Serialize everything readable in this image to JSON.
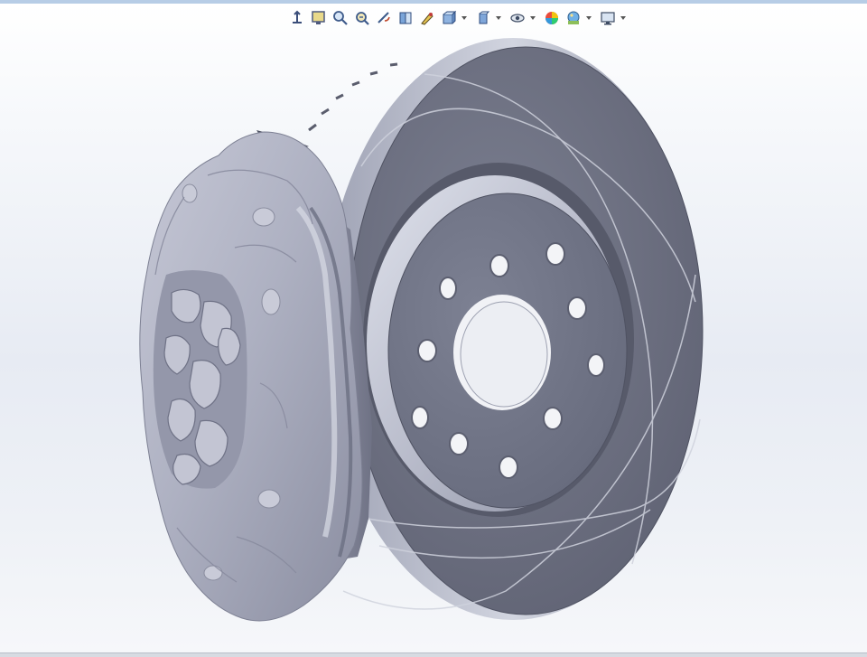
{
  "app": {
    "name": "3D CAD viewport",
    "accent_color": "#b7cde6"
  },
  "heads_up_toolbar": {
    "buttons": [
      {
        "icon": "previous-view-icon",
        "has_dropdown": false
      },
      {
        "icon": "zoom-to-fit-icon",
        "has_dropdown": false
      },
      {
        "icon": "zoom-to-area-icon",
        "has_dropdown": false
      },
      {
        "icon": "zoom-in-out-icon",
        "has_dropdown": false
      },
      {
        "icon": "rotate-view-icon",
        "has_dropdown": false
      },
      {
        "icon": "section-view-icon",
        "has_dropdown": false
      },
      {
        "icon": "dynamic-annotation-icon",
        "has_dropdown": false
      },
      {
        "icon": "view-orientation-icon",
        "has_dropdown": true
      },
      {
        "icon": "display-style-icon",
        "has_dropdown": true
      },
      {
        "icon": "hide-show-items-icon",
        "has_dropdown": true
      },
      {
        "icon": "edit-appearance-icon",
        "has_dropdown": false
      },
      {
        "icon": "apply-scene-icon",
        "has_dropdown": true
      },
      {
        "icon": "view-settings-icon",
        "has_dropdown": true
      }
    ]
  },
  "model": {
    "parts": [
      "brake-disc",
      "brake-caliper"
    ],
    "disc_color": "#6f7283",
    "caliper_color": "#a8abbc"
  }
}
